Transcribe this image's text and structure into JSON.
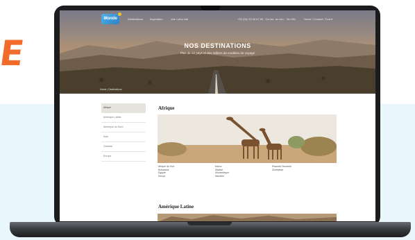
{
  "brand_mark": "E",
  "site": {
    "logo_text": "Monde",
    "nav_links": [
      "Destinations",
      "Inspiration",
      "Voir / plus info"
    ],
    "nav_right_1": "+33 (0)1 23 45 67 89 · Du lun. au ven. · 9h-19h",
    "nav_right_2": "Devis / Contact / Tout ▾"
  },
  "hero": {
    "title": "NOS DESTINATIONS",
    "subtitle": "Plus de 60 pays et des milliers de modèles de voyage",
    "breadcrumb": "Home  |  Destinations"
  },
  "sidebar": {
    "items": [
      {
        "label": "Afrique",
        "active": true
      },
      {
        "label": "Amérique Latine",
        "active": false
      },
      {
        "label": "Amérique du Nord",
        "active": false
      },
      {
        "label": "Asie",
        "active": false
      },
      {
        "label": "Océanie",
        "active": false
      },
      {
        "label": "Europe",
        "active": false
      }
    ]
  },
  "regions": [
    {
      "title": "Afrique",
      "countries": [
        [
          "Afrique du Sud",
          "Botswana",
          "Egypte",
          "Kenya"
        ],
        [
          "Maroc",
          "Malawi",
          "Mozambique",
          "Namibie"
        ],
        [
          "Rwanda Tanzanie",
          "Zimbabwe"
        ]
      ]
    },
    {
      "title": "Amérique Latine",
      "countries": []
    }
  ],
  "colors": {
    "brand_orange": "#f26b2a",
    "page_blue": "#e9f6fb",
    "laptop_body": "#1c1c1e"
  }
}
